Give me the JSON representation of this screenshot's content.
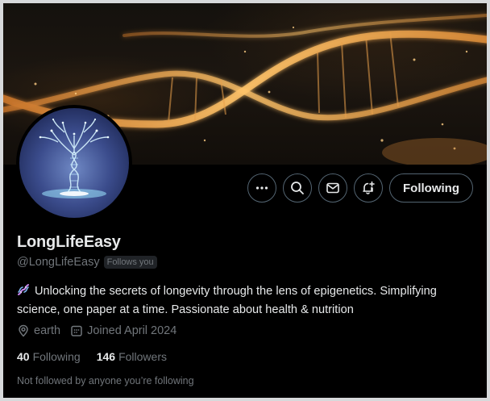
{
  "profile": {
    "display_name": "LongLifeEasy",
    "handle": "@LongLifeEasy",
    "follows_you": "Follows you",
    "bio_icon": "dna-icon",
    "bio": "Unlocking the secrets of longevity through the lens of epigenetics. Simplifying science, one paper at a time. Passionate about health & nutrition",
    "location": "earth",
    "joined": "Joined April 2024",
    "following_count": "40",
    "following_label": "Following",
    "followers_count": "146",
    "followers_label": "Followers",
    "mutuals_text": "Not followed by anyone you’re following"
  },
  "actions": {
    "more_icon": "more-icon",
    "search_icon": "search-icon",
    "message_icon": "envelope-icon",
    "notify_icon": "bell-plus-icon",
    "follow_label": "Following"
  },
  "colors": {
    "background": "#000000",
    "primary_text": "#e7e9ea",
    "secondary_text": "#71767b",
    "border": "#536471",
    "dna_glow": "#f0a650"
  }
}
